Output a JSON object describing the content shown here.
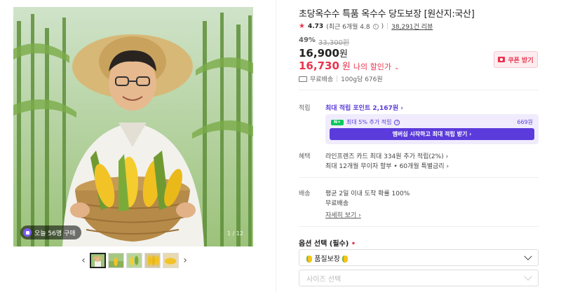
{
  "gallery": {
    "buy_badge": "오늘 56명 구매",
    "counter": "1 / 12",
    "thumbnail_count": 5
  },
  "product": {
    "title": "초당옥수수 특품 옥수수 당도보장 [원산지:국산]",
    "rating": "4.73",
    "rating_detail": "(최근 6개월 4.8",
    "rating_detail_close": ")",
    "review_count": "38,291건 리뷰",
    "discount_rate": "49%",
    "original_price": "33,300원",
    "price_num": "16,900",
    "price_unit": "원",
    "my_price_num": "16,730",
    "my_price_unit": "원",
    "my_price_label": "나의 할인가",
    "coupon_button": "쿠폰 받기",
    "shipping_summary": "무료배송",
    "unit_price": "100g당 676원"
  },
  "points": {
    "label": "적립",
    "max_points": "최대 적립 포인트 2,167원",
    "member_line": "최대 5% 추가 적립",
    "member_amount": "669원",
    "member_button": "멤버십 시작하고 최대 적립 받기"
  },
  "benefits": {
    "label": "혜택",
    "line1": "라인프렌즈 카드 최대 334원 추가 적립(2%)",
    "line2": "최대 12개월 무이자 할부 • 60개월 특별금리"
  },
  "delivery": {
    "label": "배송",
    "line1": "평균 2일 이내 도착 확률 100%",
    "line2": "무료배송",
    "detail_link": "자세히 보기"
  },
  "options": {
    "title": "옵션 선택 (필수)",
    "required_mark": "•",
    "quality_select": "품질보장",
    "size_placeholder": "사이즈 선택"
  },
  "colors": {
    "accent_red": "#e8344e",
    "membership_purple": "#5b3bdb",
    "npay_green": "#03c75a"
  }
}
